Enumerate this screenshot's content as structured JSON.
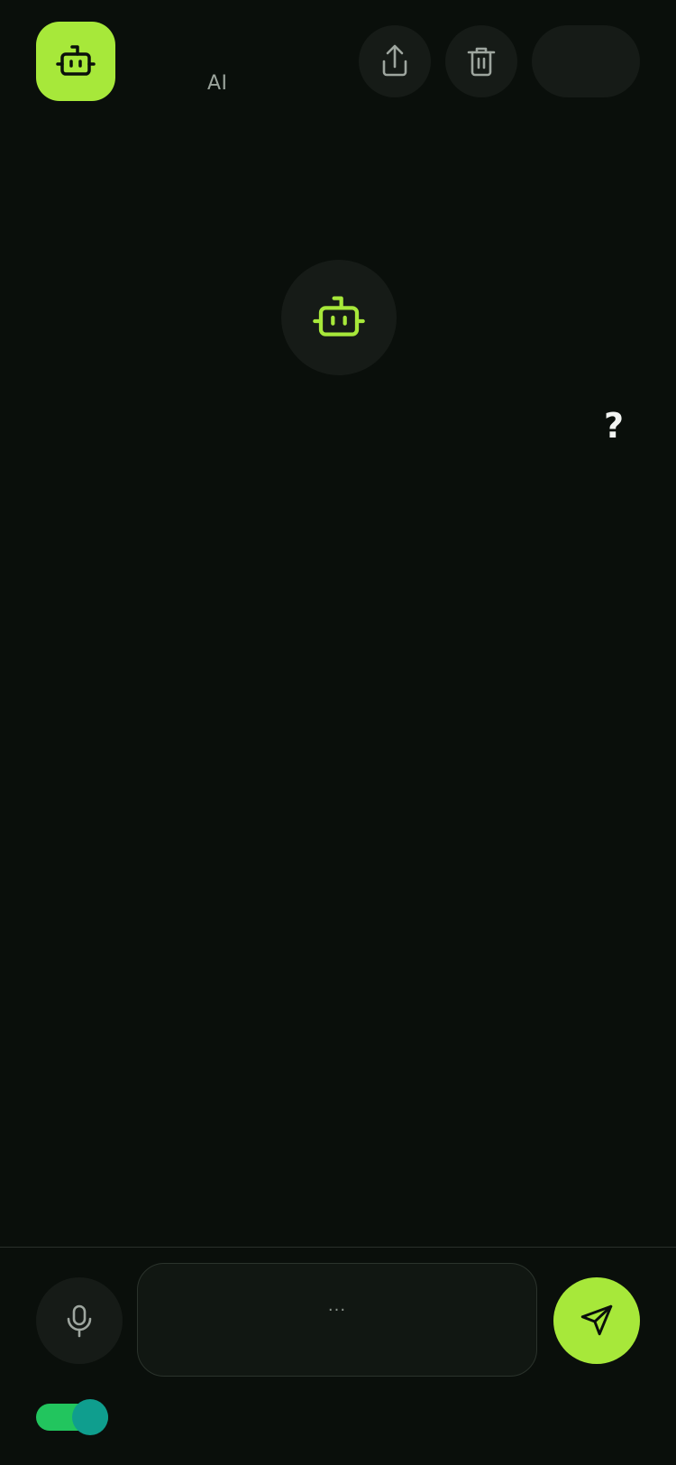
{
  "header": {
    "app_label": "AI",
    "logo_icon": "robot-icon",
    "share_icon": "share-icon",
    "delete_icon": "trash-icon"
  },
  "main": {
    "avatar_icon": "robot-icon",
    "hint_text": "?"
  },
  "composer": {
    "mic_icon": "microphone-icon",
    "placeholder": "...",
    "send_icon": "send-icon"
  },
  "toggle": {
    "state": "on"
  },
  "colors": {
    "accent": "#a7e83a",
    "background": "#0a0f0b",
    "surface": "#161b17",
    "toggle_track": "#22c55e",
    "toggle_knob": "#0f9e8e"
  }
}
